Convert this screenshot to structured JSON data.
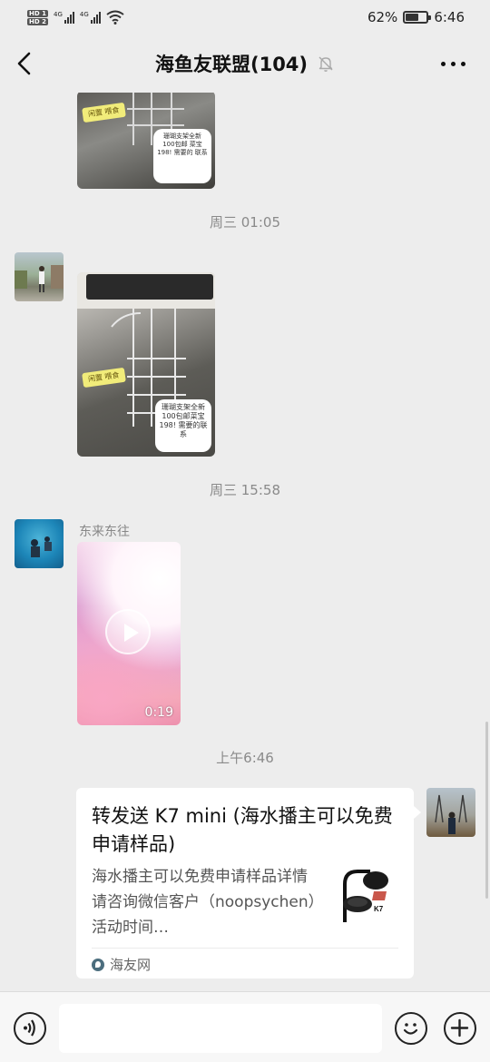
{
  "status_bar": {
    "hd1": "HD 1",
    "hd2": "HD 2",
    "net1": "4G",
    "net2": "4G",
    "battery_percent": "62%",
    "battery_level": 0.62,
    "time": "6:46"
  },
  "nav": {
    "title": "海鱼友联盟(104)",
    "back_icon": "chevron-left-icon",
    "mute_icon": "bell-off-icon",
    "more_icon": "more-dots-icon"
  },
  "messages": {
    "img1": {
      "tag": "闲置 喂食",
      "note": "珊瑚支架全新 100包邮 菜宝 198! 需要的 联系"
    },
    "timestamp1": "周三 01:05",
    "img2": {
      "tag": "闲置 喂食",
      "note": "珊瑚支架全新100包邮菜宝198! 需要的联系"
    },
    "timestamp2": "周三 15:58",
    "video": {
      "sender": "东来东往",
      "duration": "0:19"
    },
    "timestamp3": "上午6:46",
    "link": {
      "title": "转发送 K7 mini (海水播主可以免费申请样品)",
      "description": "海水播主可以免费申请样品详情请咨询微信客户（noopsychen）活动时间…",
      "source": "海友网",
      "thumb_label": "K7"
    }
  },
  "input_bar": {
    "voice_icon": "voice-icon",
    "emoji_icon": "emoji-icon",
    "plus_icon": "plus-icon",
    "placeholder": ""
  },
  "colors": {
    "background": "#ededed",
    "bubble": "#ffffff",
    "timestamp": "#8a8a8a"
  }
}
